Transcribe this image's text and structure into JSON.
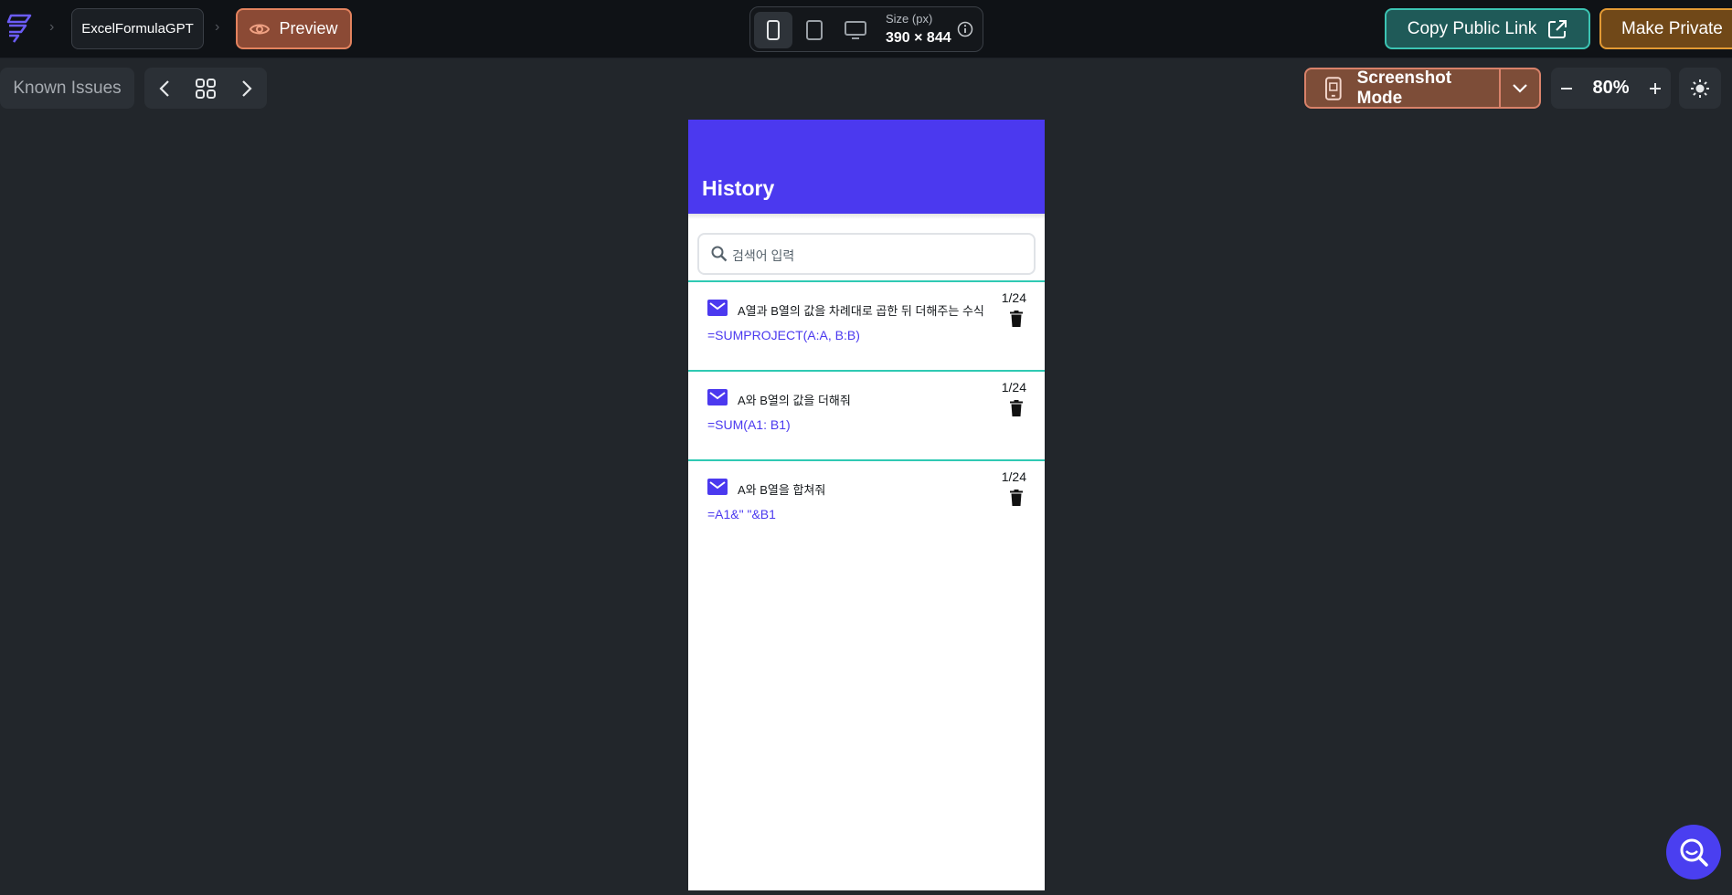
{
  "topbar": {
    "project_name": "ExcelFormulaGPT",
    "preview_label": "Preview",
    "size_label": "Size (px)",
    "size_value": "390 × 844",
    "copy_link_label": "Copy Public Link",
    "make_private_label": "Make Private"
  },
  "toolbar": {
    "known_issues_label": "Known Issues",
    "screenshot_mode_label": "Screenshot Mode",
    "zoom_value": "80%"
  },
  "app": {
    "title": "History",
    "search_placeholder": "검색어 입력",
    "items": [
      {
        "question": "A열과 B열의 값을 차례대로 곱한 뒤 더해주는 수식",
        "formula": "=SUMPROJECT(A:A, B:B)",
        "date": "1/24"
      },
      {
        "question": "A와 B열의 값을 더해줘",
        "formula": "=SUM(A1: B1)",
        "date": "1/24"
      },
      {
        "question": "A와 B열을 합쳐줘",
        "formula": "=A1&\" \"&B1",
        "date": "1/24"
      }
    ]
  },
  "colors": {
    "accent": "#4b39ef",
    "divider": "#2fc9b3",
    "preview_border": "#e3825e",
    "copy_link_border": "#3cc4b3",
    "make_private_border": "#e39a34"
  },
  "icons": [
    "app-logo-icon",
    "eye-icon",
    "phone-icon",
    "tablet-icon",
    "desktop-icon",
    "info-icon",
    "external-link-icon",
    "chevron-left-icon",
    "grid-icon",
    "chevron-right-icon",
    "mobile-screenshot-icon",
    "chevron-down-icon",
    "minus-icon",
    "plus-icon",
    "sun-icon",
    "search-icon",
    "mail-icon",
    "trash-icon",
    "support-search-icon"
  ]
}
